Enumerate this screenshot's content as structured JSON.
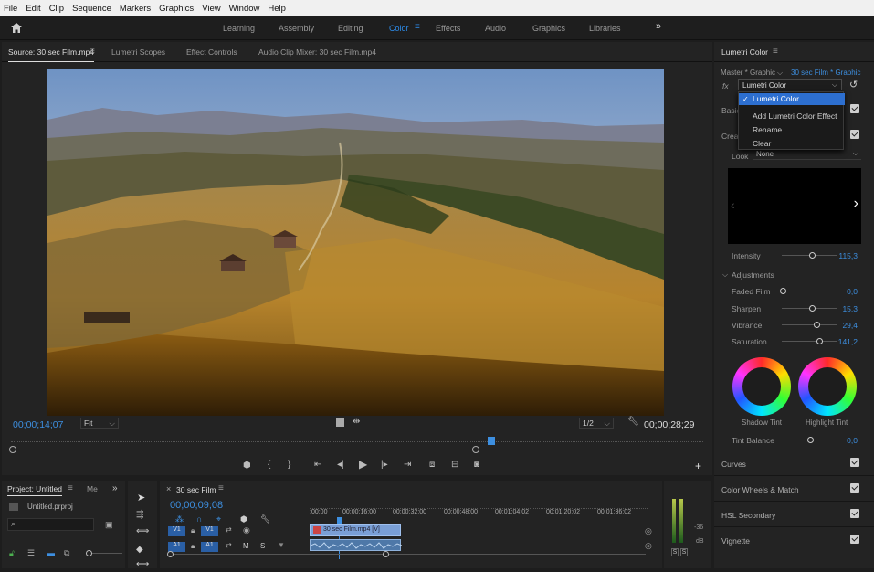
{
  "menu": [
    "File",
    "Edit",
    "Clip",
    "Sequence",
    "Markers",
    "Graphics",
    "View",
    "Window",
    "Help"
  ],
  "workspaces": [
    "Learning",
    "Assembly",
    "Editing",
    "Color",
    "Effects",
    "Audio",
    "Graphics",
    "Libraries"
  ],
  "workspace_more": "»",
  "source_panel": {
    "tabs": [
      "Source: 30 sec Film.mp4",
      "Lumetri Scopes",
      "Effect Controls",
      "Audio Clip Mixer: 30 sec Film.mp4"
    ],
    "timecode_current": "00;00;14;07",
    "fit": "Fit",
    "resolution": "1/2",
    "timecode_duration": "00;00;28;29"
  },
  "lumetri": {
    "title": "Lumetri Color",
    "master_label": "Master * Graphic",
    "clip_label": "30 sec Film * Graphic",
    "fx_label": "fx",
    "effect_select": "Lumetri Color",
    "basic_label": "Basic",
    "creative_label": "Creat",
    "look_label": "Look",
    "look_value": "None",
    "intensity": {
      "label": "Intensity",
      "value": "115,3"
    },
    "adjustments_label": "Adjustments",
    "sliders": [
      {
        "label": "Faded Film",
        "value": "0,0"
      },
      {
        "label": "Sharpen",
        "value": "15,3"
      },
      {
        "label": "Vibrance",
        "value": "29,4"
      },
      {
        "label": "Saturation",
        "value": "141,2"
      }
    ],
    "shadow_tint": "Shadow Tint",
    "highlight_tint": "Highlight Tint",
    "tint_balance": {
      "label": "Tint Balance",
      "value": "0,0"
    },
    "sections": [
      "Curves",
      "Color Wheels & Match",
      "HSL Secondary",
      "Vignette"
    ]
  },
  "dropdown": {
    "items": [
      "Lumetri Color",
      "Add Lumetri Color Effect",
      "Rename",
      "Clear"
    ]
  },
  "project": {
    "tab": "Project: Untitled",
    "tab2": "Me",
    "file": "Untitled.prproj"
  },
  "timeline": {
    "tab": "30 sec Film",
    "timecode": "00;00;09;08",
    "ruler": [
      ";00;00",
      "00;00;16;00",
      "00;00;32;00",
      "00;00;48;00",
      "00;01;04;02",
      "00;01;20;02",
      "00;01;36;02"
    ],
    "v1": "V1",
    "a1": "A1",
    "clip_name": "30 sec Film.mp4 [V]",
    "m": "M",
    "s": "S"
  },
  "meter": {
    "labels": [
      "-36",
      "dB"
    ],
    "solo": [
      "S",
      "S"
    ]
  }
}
